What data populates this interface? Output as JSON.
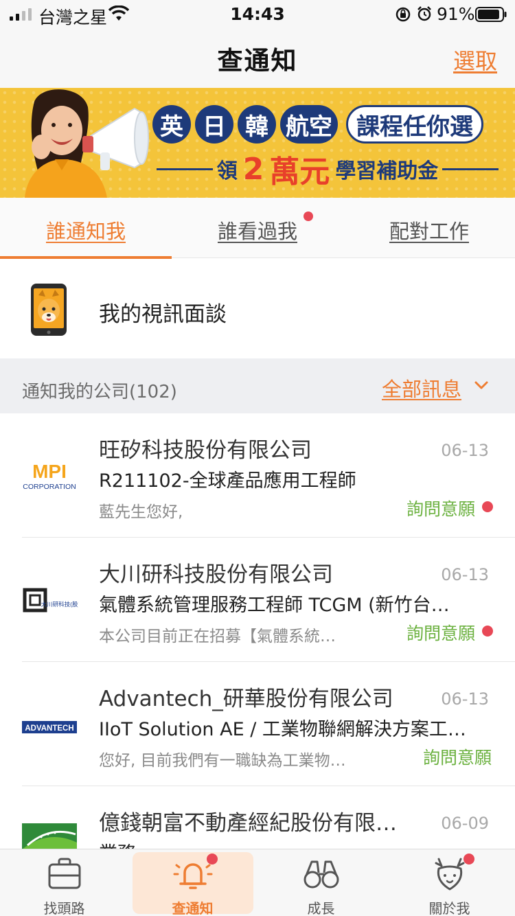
{
  "status_bar": {
    "carrier": "台灣之星",
    "time": "14:43",
    "battery_percent": "91%",
    "battery_level": 0.91
  },
  "nav": {
    "title": "查通知",
    "select_label": "選取"
  },
  "banner": {
    "pills": [
      "英",
      "日",
      "韓",
      "航空"
    ],
    "slogan": "課程任你選",
    "sub_prefix": "領",
    "sub_number": "2",
    "sub_big": "萬元",
    "sub_suffix": "學習補助金"
  },
  "tabs": [
    {
      "label": "誰通知我",
      "active": true,
      "badge": false
    },
    {
      "label": "誰看過我",
      "active": false,
      "badge": true
    },
    {
      "label": "配對工作",
      "active": false,
      "badge": false
    }
  ],
  "video_interview": {
    "label": "我的視訊面談"
  },
  "section": {
    "label": "通知我的公司(102)",
    "filter_label": "全部訊息"
  },
  "notifications": [
    {
      "company": "旺矽科技股份有限公司",
      "logo_text": "MPI",
      "logo_subtext": "CORPORATION",
      "date": "06-13",
      "job": "R211102-全球產品應用工程師",
      "preview": "藍先生您好,",
      "status": "詢問意願",
      "unread": true
    },
    {
      "company": "大川研科技股份有限公司",
      "logo_text": "大川研科技(股)",
      "date": "06-13",
      "job": "氣體系統管理服務工程師 TCGM (新竹台…",
      "preview": "本公司目前正在招募【氣體系統…",
      "status": "詢問意願",
      "unread": true
    },
    {
      "company": "Advantech_研華股份有限公司",
      "logo_text": "ADVANTECH",
      "date": "06-13",
      "job": "IIoT Solution AE / 工業物聯網解決方案工…",
      "preview": "您好, 目前我們有一職缺為工業物…",
      "status": "詢問意願",
      "unread": false
    },
    {
      "company": "億錢朝富不動產經紀股份有限…",
      "date": "06-09",
      "job": "業務",
      "preview": "",
      "status": "",
      "unread": false
    }
  ],
  "tab_bar": [
    {
      "label": "找頭路",
      "icon": "briefcase-icon",
      "active": false,
      "badge": false
    },
    {
      "label": "查通知",
      "icon": "bell-icon",
      "active": true,
      "badge": true
    },
    {
      "label": "成長",
      "icon": "binoculars-icon",
      "active": false,
      "badge": false
    },
    {
      "label": "關於我",
      "icon": "deer-face-icon",
      "active": false,
      "badge": true
    }
  ],
  "colors": {
    "accent": "#ee7d32",
    "status_green": "#6bb13f",
    "badge_red": "#e84856",
    "banner_yellow": "#f4c43a",
    "banner_navy": "#1e3a7a"
  }
}
